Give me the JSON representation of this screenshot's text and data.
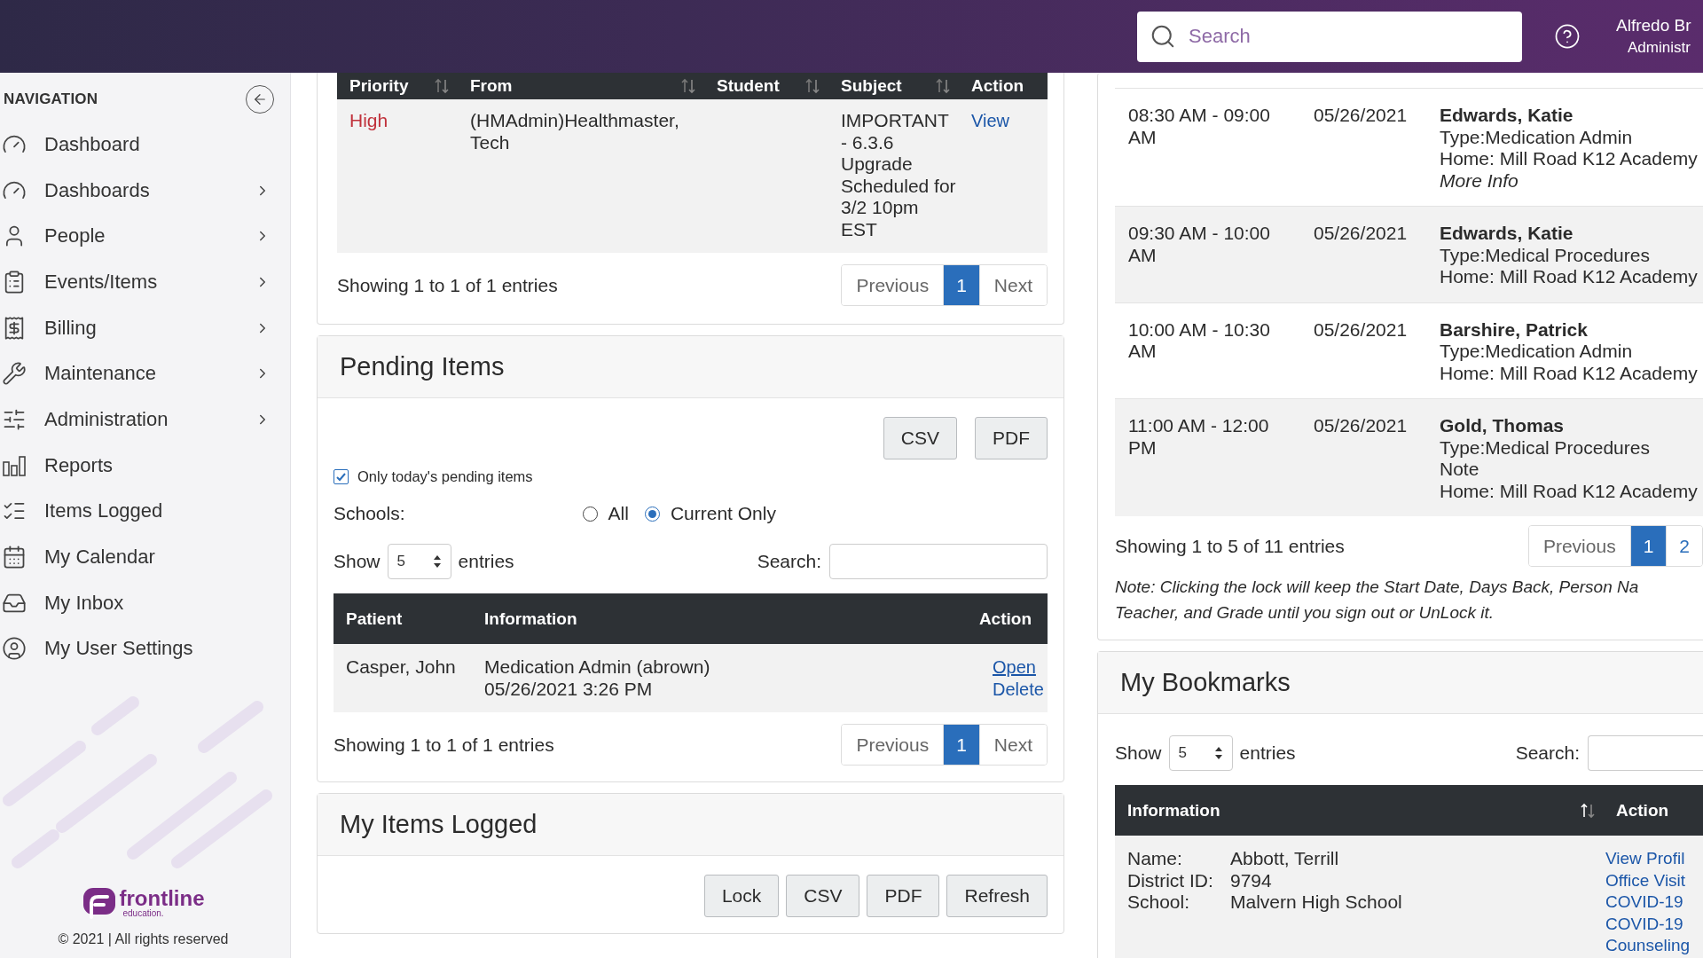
{
  "header": {
    "search": {
      "placeholder": "Search"
    },
    "user": {
      "name": "Alfredo Br",
      "role": "Administr"
    }
  },
  "sidebar": {
    "title": "NAVIGATION",
    "items": [
      {
        "label": "Dashboard",
        "submenu": false
      },
      {
        "label": "Dashboards",
        "submenu": true
      },
      {
        "label": "People",
        "submenu": true
      },
      {
        "label": "Events/Items",
        "submenu": true
      },
      {
        "label": "Billing",
        "submenu": true
      },
      {
        "label": "Maintenance",
        "submenu": true
      },
      {
        "label": "Administration",
        "submenu": true
      },
      {
        "label": "Reports",
        "submenu": false
      },
      {
        "label": "Items Logged",
        "submenu": false
      },
      {
        "label": "My Calendar",
        "submenu": false
      },
      {
        "label": "My Inbox",
        "submenu": false
      },
      {
        "label": "My User Settings",
        "submenu": false
      }
    ],
    "footer": {
      "logo_name": "frontline",
      "logo_sub": "education.",
      "copyright": "© 2021 | All rights reserved"
    }
  },
  "messages": {
    "columns": [
      {
        "label": "Priority",
        "sortable": true
      },
      {
        "label": "From",
        "sortable": true
      },
      {
        "label": "Student",
        "sortable": true
      },
      {
        "label": "Subject",
        "sortable": true
      },
      {
        "label": "Action",
        "sortable": false
      }
    ],
    "rows": [
      {
        "priority": "High",
        "from": "(HMAdmin)Healthmaster, Tech",
        "subject": "IMPORTANT - 6.3.6 Upgrade Scheduled for 3/2 10pm EST",
        "action": "View"
      }
    ],
    "info": "Showing 1 to 1 of 1 entries",
    "pagination": {
      "previous": "Previous",
      "pages": [
        {
          "label": "1",
          "selected": true
        }
      ],
      "next": "Next"
    }
  },
  "pending": {
    "title": "Pending Items",
    "buttons": [
      "CSV",
      "PDF"
    ],
    "filter": {
      "label": "Only today's pending items",
      "checked": true
    },
    "schools": {
      "label": "Schools:",
      "options": [
        {
          "label": "All",
          "selected": false
        },
        {
          "label": "Current Only",
          "selected": true
        }
      ]
    },
    "length": {
      "before": "Show",
      "value": "5",
      "after": "entries"
    },
    "search_label": "Search:",
    "columns": [
      "Patient",
      "Information",
      "Action"
    ],
    "rows": [
      {
        "patient": "Casper, John",
        "information": [
          "Medication Admin (abrown)",
          "05/26/2021 3:26 PM"
        ],
        "actions": [
          "Open",
          "Delete"
        ]
      }
    ],
    "info": "Showing 1 to 1 of 1 entries",
    "pagination": {
      "previous": "Previous",
      "pages": [
        {
          "label": "1",
          "selected": true
        }
      ],
      "next": "Next"
    }
  },
  "items_logged": {
    "title": "My Items Logged",
    "buttons": [
      "Lock",
      "CSV",
      "PDF",
      "Refresh"
    ]
  },
  "schedule": {
    "rows": [
      {
        "time": "08:30 AM - 09:00 AM",
        "date": "05/26/2021",
        "name": "Edwards, Katie",
        "lines": [
          {
            "text": "Type:Medication Admin",
            "kind": "plain"
          },
          {
            "text": "Home: Mill Road K12 Academy",
            "kind": "plain"
          },
          {
            "text": "More Info",
            "kind": "italic"
          }
        ]
      },
      {
        "time": "09:30 AM - 10:00 AM",
        "date": "05/26/2021",
        "name": "Edwards, Katie",
        "lines": [
          {
            "text": "Type:Medical Procedures",
            "kind": "plain"
          },
          {
            "text": "Home: Mill Road K12 Academy",
            "kind": "plain"
          }
        ]
      },
      {
        "time": "10:00 AM - 10:30 AM",
        "date": "05/26/2021",
        "name": "Barshire, Patrick",
        "lines": [
          {
            "text": "Type:Medication Admin",
            "kind": "plain"
          },
          {
            "text": "Home: Mill Road K12 Academy",
            "kind": "plain"
          }
        ]
      },
      {
        "time": "11:00 AM - 12:00 PM",
        "date": "05/26/2021",
        "name": "Gold, Thomas",
        "lines": [
          {
            "text": "Type:Medical Procedures",
            "kind": "plain"
          },
          {
            "text": "Note",
            "kind": "plain"
          },
          {
            "text": "Home: Mill Road K12 Academy",
            "kind": "plain"
          }
        ]
      }
    ],
    "info": "Showing 1 to 5 of 11 entries",
    "pagination": {
      "previous": "Previous",
      "pages": [
        {
          "label": "1",
          "selected": true
        },
        {
          "label": "2",
          "selected": false
        }
      ]
    },
    "note": [
      "Note: Clicking the lock will keep the Start Date, Days Back, Person Na",
      "Teacher, and Grade until you sign out or UnLock it."
    ]
  },
  "bookmarks": {
    "title": "My Bookmarks",
    "length": {
      "before": "Show",
      "value": "5",
      "after": "entries"
    },
    "search_label": "Search:",
    "columns": [
      {
        "label": "Information",
        "sortable": true
      },
      {
        "label": "Action",
        "sortable": false
      }
    ],
    "rows": [
      {
        "fields": [
          {
            "label": "Name:",
            "value": "Abbott, Terrill"
          },
          {
            "label": "District ID:",
            "value": "9794"
          },
          {
            "label": "School:",
            "value": "Malvern High School"
          }
        ],
        "actions": [
          "View Profil",
          "Office Visit",
          "COVID-19",
          "COVID-19",
          "Counseling"
        ]
      }
    ]
  }
}
